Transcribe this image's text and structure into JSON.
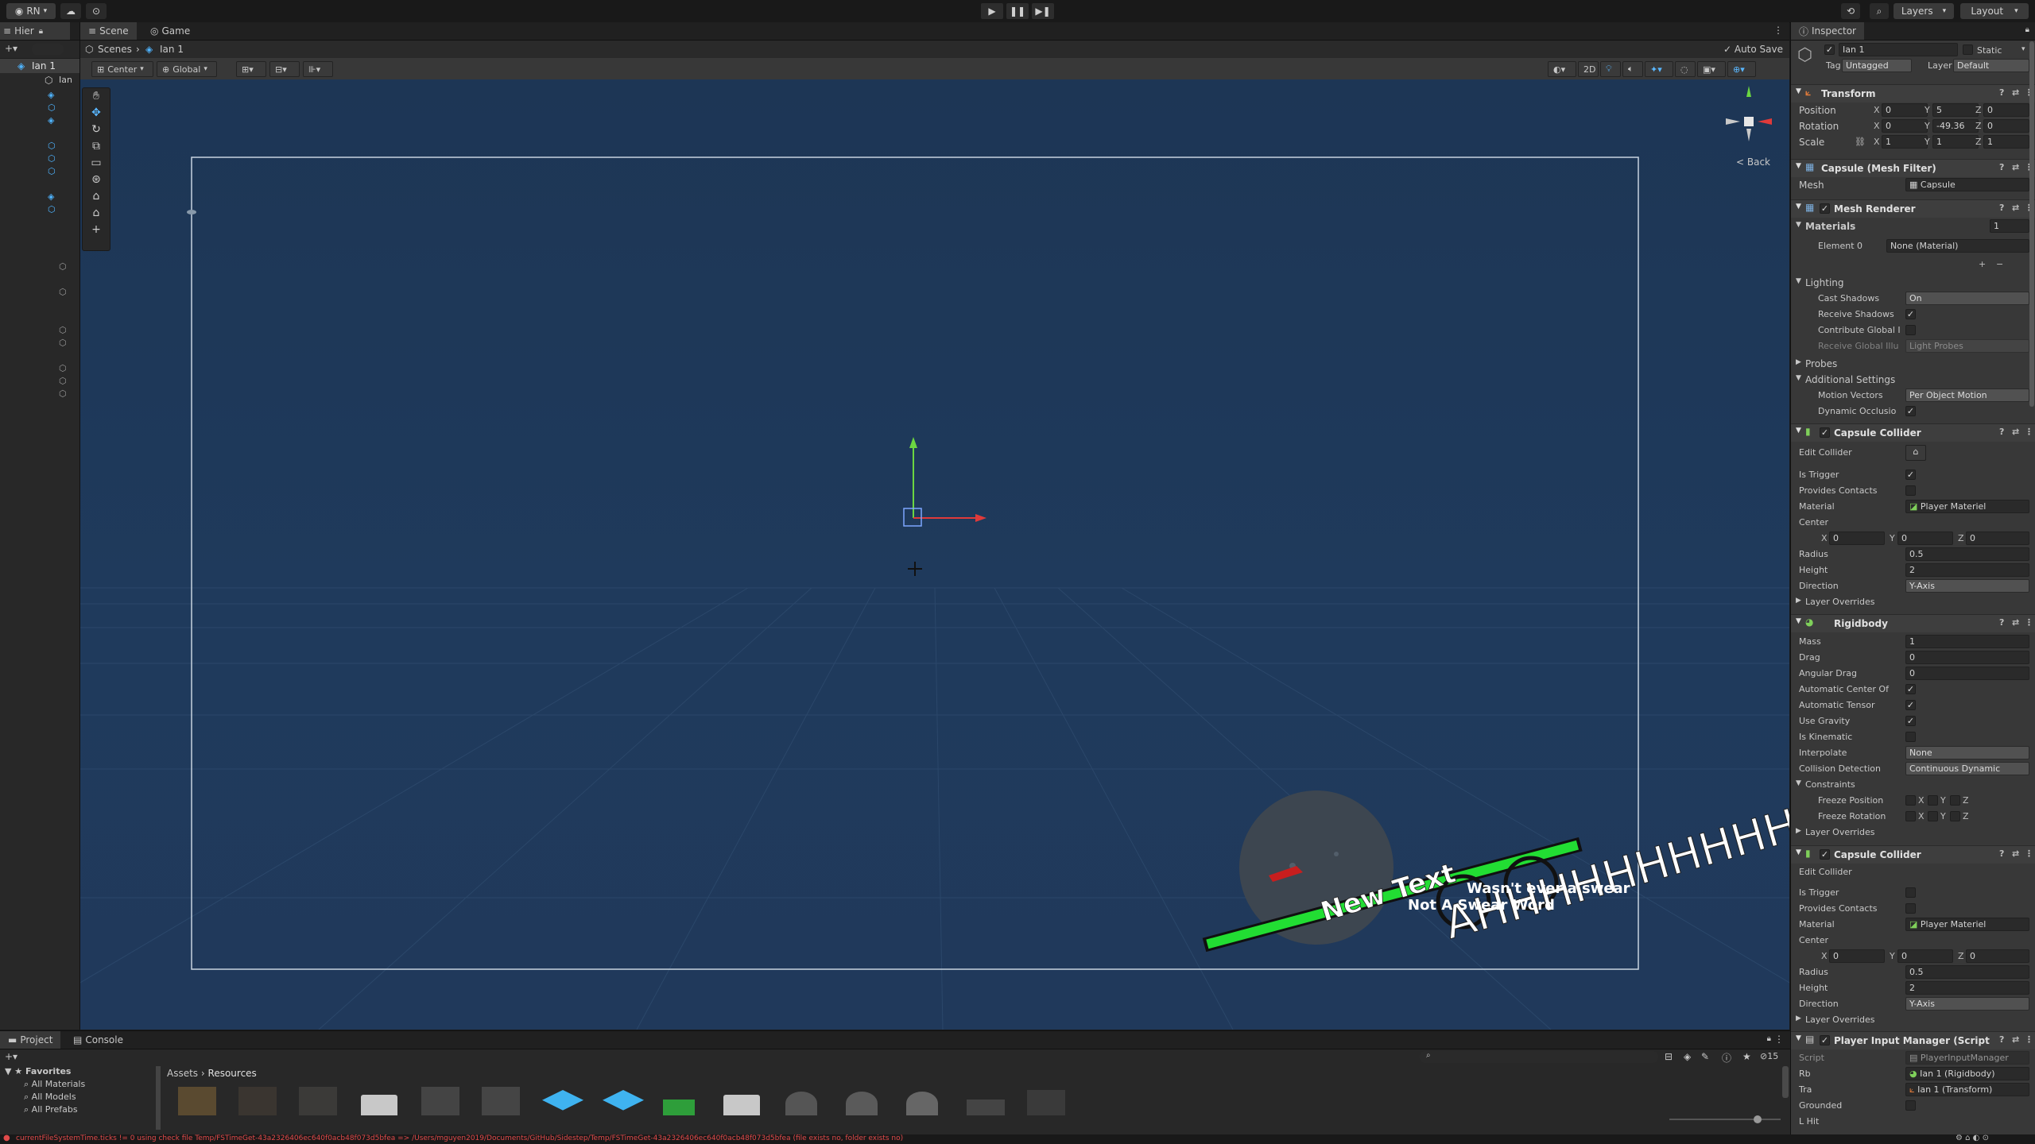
{
  "topbar": {
    "account": "RN",
    "layers": "Layers",
    "layout": "Layout"
  },
  "hierarchy": {
    "tab": "Hier",
    "root": "Ian 1",
    "first_item": "Ian"
  },
  "scene": {
    "tabs": [
      "Scene",
      "Game"
    ],
    "breadcrumb": [
      "Scenes",
      "Ian 1"
    ],
    "auto_save": "Auto Save",
    "pivot": "Center",
    "space": "Global",
    "mode_2d": "2D",
    "gizmo_label": "< Back"
  },
  "game_ui": {
    "new_text": "New Text",
    "scream": "AHHHHHHHHHH",
    "wasnt": "Wasn't ever a swear",
    "not_swear": "Not A Swear Word"
  },
  "inspector": {
    "tab": "Inspector",
    "object_name": "Ian 1",
    "static": "Static",
    "tag_label": "Tag",
    "tag": "Untagged",
    "layer_label": "Layer",
    "layer": "Default",
    "transform": {
      "title": "Transform",
      "position": {
        "label": "Position",
        "x": "0",
        "y": "5",
        "z": "0"
      },
      "rotation": {
        "label": "Rotation",
        "x": "0",
        "y": "-49.36",
        "z": "0"
      },
      "scale": {
        "label": "Scale",
        "x": "1",
        "y": "1",
        "z": "1"
      }
    },
    "mesh_filter": {
      "title": "Capsule (Mesh Filter)",
      "mesh_label": "Mesh",
      "mesh": "Capsule"
    },
    "mesh_renderer": {
      "title": "Mesh Renderer",
      "materials": "Materials",
      "materials_count": "1",
      "element0_label": "Element 0",
      "element0": "None (Material)",
      "lighting": "Lighting",
      "cast_shadows_label": "Cast Shadows",
      "cast_shadows": "On",
      "receive_shadows": "Receive Shadows",
      "contribute_gi": "Contribute Global I",
      "receive_gi_label": "Receive Global Illu",
      "receive_gi": "Light Probes",
      "probes": "Probes",
      "additional": "Additional Settings",
      "motion_vectors_label": "Motion Vectors",
      "motion_vectors": "Per Object Motion",
      "dynamic_occlusion": "Dynamic Occlusio"
    },
    "capsule1": {
      "title": "Capsule Collider",
      "edit_collider": "Edit Collider",
      "is_trigger": "Is Trigger",
      "provides_contacts": "Provides Contacts",
      "material_label": "Material",
      "material": "Player Materiel",
      "center": "Center",
      "cx": "0",
      "cy": "0",
      "cz": "0",
      "radius_label": "Radius",
      "radius": "0.5",
      "height_label": "Height",
      "height": "2",
      "direction_label": "Direction",
      "direction": "Y-Axis",
      "layer_overrides": "Layer Overrides"
    },
    "rigidbody": {
      "title": "Rigidbody",
      "mass_label": "Mass",
      "mass": "1",
      "drag_label": "Drag",
      "drag": "0",
      "angular_drag_label": "Angular Drag",
      "angular_drag": "0",
      "auto_center": "Automatic Center Of",
      "auto_tensor": "Automatic Tensor",
      "use_gravity": "Use Gravity",
      "is_kinematic": "Is Kinematic",
      "interpolate_label": "Interpolate",
      "interpolate": "None",
      "collision_label": "Collision Detection",
      "collision": "Continuous Dynamic",
      "constraints": "Constraints",
      "freeze_pos": "Freeze Position",
      "freeze_rot": "Freeze Rotation",
      "layer_overrides": "Layer Overrides"
    },
    "capsule2": {
      "title": "Capsule Collider",
      "edit_collider": "Edit Collider",
      "is_trigger": "Is Trigger",
      "provides_contacts": "Provides Contacts",
      "material_label": "Material",
      "material": "Player Materiel",
      "center": "Center",
      "cx": "0",
      "cy": "0",
      "cz": "0",
      "radius_label": "Radius",
      "radius": "0.5",
      "height_label": "Height",
      "height": "2",
      "direction_label": "Direction",
      "direction": "Y-Axis",
      "layer_overrides": "Layer Overrides"
    },
    "pim": {
      "title": "Player Input Manager (Script",
      "script_label": "Script",
      "script": "PlayerInputManager",
      "rb_label": "Rb",
      "rb": "Ian 1 (Rigidbody)",
      "tra_label": "Tra",
      "tra": "Ian 1 (Transform)",
      "grounded": "Grounded",
      "lhit": "L Hit"
    }
  },
  "project": {
    "tabs": [
      "Project",
      "Console"
    ],
    "favorites": "Favorites",
    "fav_items": [
      "All Materials",
      "All Models",
      "All Prefabs"
    ],
    "breadcrumb": [
      "Assets",
      "Resources"
    ],
    "count": "15"
  },
  "status": {
    "message": "currentFileSystemTime.ticks != 0 using check file Temp/FSTimeGet-43a2326406ec640f0acb48f073d5bfea => /Users/mguyen2019/Documents/GitHub/Sidestep/Temp/FSTimeGet-43a2326406ec640f0acb48f073d5bfea (file exists no, folder exists no)"
  }
}
